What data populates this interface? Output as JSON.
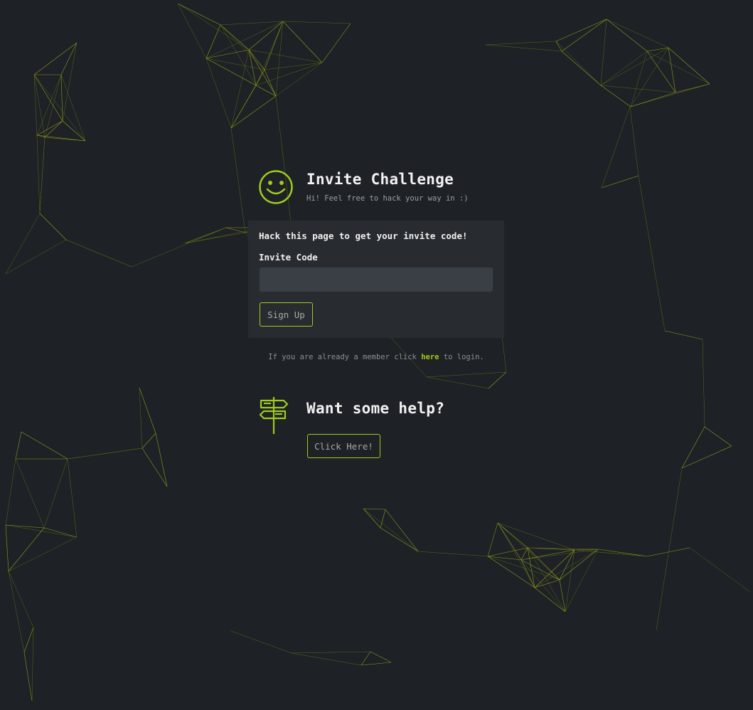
{
  "header": {
    "title": "Invite Challenge",
    "subtitle": "Hi! Feel free to hack your way in :)",
    "icon": "smiley-icon"
  },
  "form": {
    "heading": "Hack this page to get your invite code!",
    "code_label": "Invite Code",
    "code_value": "",
    "code_placeholder": "",
    "submit_label": "Sign Up"
  },
  "login": {
    "prefix": "If you are already a member click ",
    "link_text": "here",
    "suffix": " to login."
  },
  "help": {
    "icon": "signpost-icon",
    "title": "Want some help?",
    "button_label": "Click Here!"
  },
  "colors": {
    "background": "#1e2126",
    "panel": "#282c31",
    "accent": "#9fcc1c",
    "input": "#3a3f46"
  }
}
